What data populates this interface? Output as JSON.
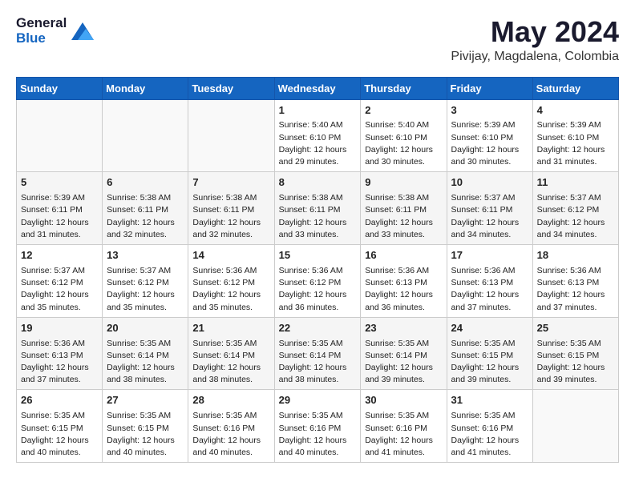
{
  "header": {
    "logo_general": "General",
    "logo_blue": "Blue",
    "month_year": "May 2024",
    "location": "Pivijay, Magdalena, Colombia"
  },
  "days_of_week": [
    "Sunday",
    "Monday",
    "Tuesday",
    "Wednesday",
    "Thursday",
    "Friday",
    "Saturday"
  ],
  "weeks": [
    [
      {
        "day": "",
        "content": ""
      },
      {
        "day": "",
        "content": ""
      },
      {
        "day": "",
        "content": ""
      },
      {
        "day": "1",
        "content": "Sunrise: 5:40 AM\nSunset: 6:10 PM\nDaylight: 12 hours\nand 29 minutes."
      },
      {
        "day": "2",
        "content": "Sunrise: 5:40 AM\nSunset: 6:10 PM\nDaylight: 12 hours\nand 30 minutes."
      },
      {
        "day": "3",
        "content": "Sunrise: 5:39 AM\nSunset: 6:10 PM\nDaylight: 12 hours\nand 30 minutes."
      },
      {
        "day": "4",
        "content": "Sunrise: 5:39 AM\nSunset: 6:10 PM\nDaylight: 12 hours\nand 31 minutes."
      }
    ],
    [
      {
        "day": "5",
        "content": "Sunrise: 5:39 AM\nSunset: 6:11 PM\nDaylight: 12 hours\nand 31 minutes."
      },
      {
        "day": "6",
        "content": "Sunrise: 5:38 AM\nSunset: 6:11 PM\nDaylight: 12 hours\nand 32 minutes."
      },
      {
        "day": "7",
        "content": "Sunrise: 5:38 AM\nSunset: 6:11 PM\nDaylight: 12 hours\nand 32 minutes."
      },
      {
        "day": "8",
        "content": "Sunrise: 5:38 AM\nSunset: 6:11 PM\nDaylight: 12 hours\nand 33 minutes."
      },
      {
        "day": "9",
        "content": "Sunrise: 5:38 AM\nSunset: 6:11 PM\nDaylight: 12 hours\nand 33 minutes."
      },
      {
        "day": "10",
        "content": "Sunrise: 5:37 AM\nSunset: 6:11 PM\nDaylight: 12 hours\nand 34 minutes."
      },
      {
        "day": "11",
        "content": "Sunrise: 5:37 AM\nSunset: 6:12 PM\nDaylight: 12 hours\nand 34 minutes."
      }
    ],
    [
      {
        "day": "12",
        "content": "Sunrise: 5:37 AM\nSunset: 6:12 PM\nDaylight: 12 hours\nand 35 minutes."
      },
      {
        "day": "13",
        "content": "Sunrise: 5:37 AM\nSunset: 6:12 PM\nDaylight: 12 hours\nand 35 minutes."
      },
      {
        "day": "14",
        "content": "Sunrise: 5:36 AM\nSunset: 6:12 PM\nDaylight: 12 hours\nand 35 minutes."
      },
      {
        "day": "15",
        "content": "Sunrise: 5:36 AM\nSunset: 6:12 PM\nDaylight: 12 hours\nand 36 minutes."
      },
      {
        "day": "16",
        "content": "Sunrise: 5:36 AM\nSunset: 6:13 PM\nDaylight: 12 hours\nand 36 minutes."
      },
      {
        "day": "17",
        "content": "Sunrise: 5:36 AM\nSunset: 6:13 PM\nDaylight: 12 hours\nand 37 minutes."
      },
      {
        "day": "18",
        "content": "Sunrise: 5:36 AM\nSunset: 6:13 PM\nDaylight: 12 hours\nand 37 minutes."
      }
    ],
    [
      {
        "day": "19",
        "content": "Sunrise: 5:36 AM\nSunset: 6:13 PM\nDaylight: 12 hours\nand 37 minutes."
      },
      {
        "day": "20",
        "content": "Sunrise: 5:35 AM\nSunset: 6:14 PM\nDaylight: 12 hours\nand 38 minutes."
      },
      {
        "day": "21",
        "content": "Sunrise: 5:35 AM\nSunset: 6:14 PM\nDaylight: 12 hours\nand 38 minutes."
      },
      {
        "day": "22",
        "content": "Sunrise: 5:35 AM\nSunset: 6:14 PM\nDaylight: 12 hours\nand 38 minutes."
      },
      {
        "day": "23",
        "content": "Sunrise: 5:35 AM\nSunset: 6:14 PM\nDaylight: 12 hours\nand 39 minutes."
      },
      {
        "day": "24",
        "content": "Sunrise: 5:35 AM\nSunset: 6:15 PM\nDaylight: 12 hours\nand 39 minutes."
      },
      {
        "day": "25",
        "content": "Sunrise: 5:35 AM\nSunset: 6:15 PM\nDaylight: 12 hours\nand 39 minutes."
      }
    ],
    [
      {
        "day": "26",
        "content": "Sunrise: 5:35 AM\nSunset: 6:15 PM\nDaylight: 12 hours\nand 40 minutes."
      },
      {
        "day": "27",
        "content": "Sunrise: 5:35 AM\nSunset: 6:15 PM\nDaylight: 12 hours\nand 40 minutes."
      },
      {
        "day": "28",
        "content": "Sunrise: 5:35 AM\nSunset: 6:16 PM\nDaylight: 12 hours\nand 40 minutes."
      },
      {
        "day": "29",
        "content": "Sunrise: 5:35 AM\nSunset: 6:16 PM\nDaylight: 12 hours\nand 40 minutes."
      },
      {
        "day": "30",
        "content": "Sunrise: 5:35 AM\nSunset: 6:16 PM\nDaylight: 12 hours\nand 41 minutes."
      },
      {
        "day": "31",
        "content": "Sunrise: 5:35 AM\nSunset: 6:16 PM\nDaylight: 12 hours\nand 41 minutes."
      },
      {
        "day": "",
        "content": ""
      }
    ]
  ]
}
